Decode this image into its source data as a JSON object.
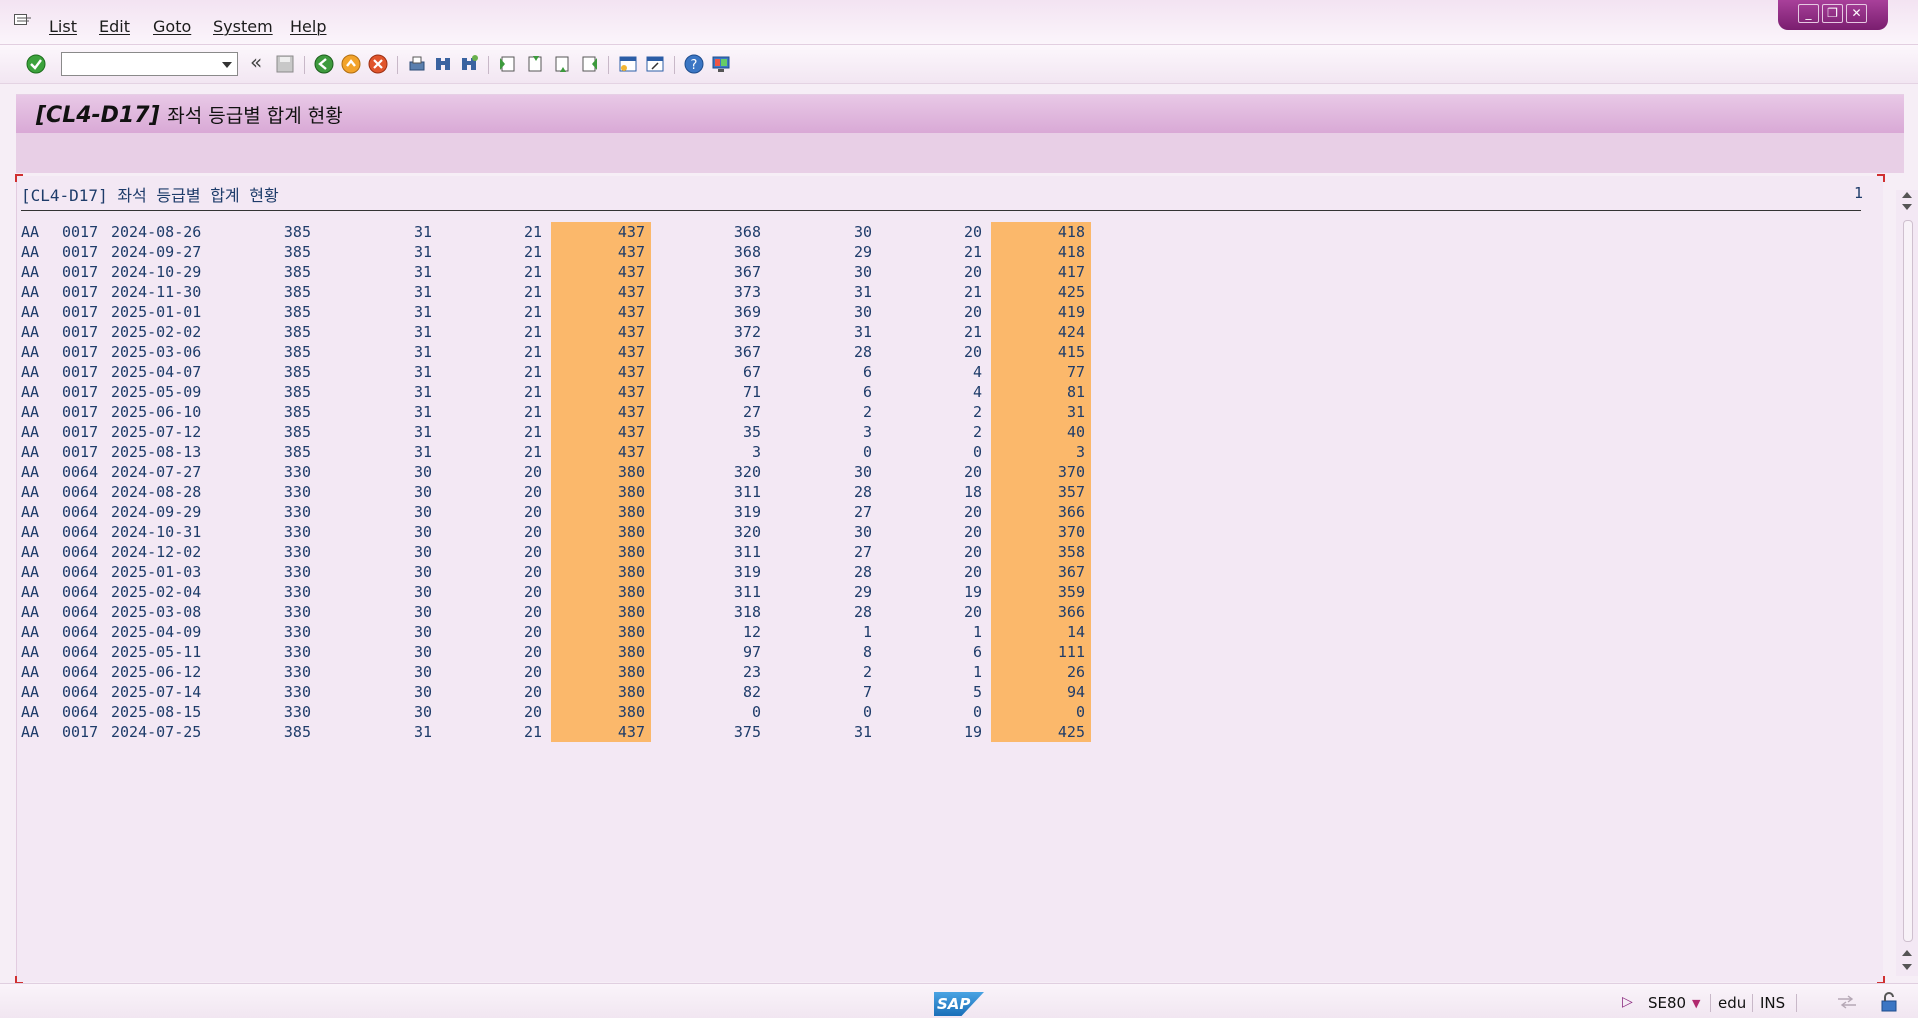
{
  "menu": {
    "items": [
      {
        "label": "List"
      },
      {
        "label": "Edit"
      },
      {
        "label": "Goto"
      },
      {
        "label": "System"
      },
      {
        "label": "Help"
      }
    ]
  },
  "toolbar": {
    "command_value": "",
    "icons": [
      "enter-check-icon",
      "save-icon",
      "back-icon",
      "exit-icon",
      "cancel-icon",
      "print-icon",
      "find-icon",
      "find-next-icon",
      "first-page-icon",
      "previous-page-icon",
      "next-page-icon",
      "last-page-icon",
      "create-session-icon",
      "shortcut-icon",
      "help-icon",
      "customize-layout-icon"
    ]
  },
  "title": {
    "code": "[CL4-D17]",
    "text": "좌석 등급별 합계 현황"
  },
  "list": {
    "header": "[CL4-D17] 좌석 등급별 합계 현황",
    "page_number": "1",
    "rows": [
      {
        "carrid": "AA",
        "connid": "0017",
        "fldate": "2024-08-26",
        "max1": "385",
        "max2": "31",
        "max3": "21",
        "tot1": "437",
        "occ1": "368",
        "occ2": "30",
        "occ3": "20",
        "tot2": "418"
      },
      {
        "carrid": "AA",
        "connid": "0017",
        "fldate": "2024-09-27",
        "max1": "385",
        "max2": "31",
        "max3": "21",
        "tot1": "437",
        "occ1": "368",
        "occ2": "29",
        "occ3": "21",
        "tot2": "418"
      },
      {
        "carrid": "AA",
        "connid": "0017",
        "fldate": "2024-10-29",
        "max1": "385",
        "max2": "31",
        "max3": "21",
        "tot1": "437",
        "occ1": "367",
        "occ2": "30",
        "occ3": "20",
        "tot2": "417"
      },
      {
        "carrid": "AA",
        "connid": "0017",
        "fldate": "2024-11-30",
        "max1": "385",
        "max2": "31",
        "max3": "21",
        "tot1": "437",
        "occ1": "373",
        "occ2": "31",
        "occ3": "21",
        "tot2": "425"
      },
      {
        "carrid": "AA",
        "connid": "0017",
        "fldate": "2025-01-01",
        "max1": "385",
        "max2": "31",
        "max3": "21",
        "tot1": "437",
        "occ1": "369",
        "occ2": "30",
        "occ3": "20",
        "tot2": "419"
      },
      {
        "carrid": "AA",
        "connid": "0017",
        "fldate": "2025-02-02",
        "max1": "385",
        "max2": "31",
        "max3": "21",
        "tot1": "437",
        "occ1": "372",
        "occ2": "31",
        "occ3": "21",
        "tot2": "424"
      },
      {
        "carrid": "AA",
        "connid": "0017",
        "fldate": "2025-03-06",
        "max1": "385",
        "max2": "31",
        "max3": "21",
        "tot1": "437",
        "occ1": "367",
        "occ2": "28",
        "occ3": "20",
        "tot2": "415"
      },
      {
        "carrid": "AA",
        "connid": "0017",
        "fldate": "2025-04-07",
        "max1": "385",
        "max2": "31",
        "max3": "21",
        "tot1": "437",
        "occ1": "67",
        "occ2": "6",
        "occ3": "4",
        "tot2": "77"
      },
      {
        "carrid": "AA",
        "connid": "0017",
        "fldate": "2025-05-09",
        "max1": "385",
        "max2": "31",
        "max3": "21",
        "tot1": "437",
        "occ1": "71",
        "occ2": "6",
        "occ3": "4",
        "tot2": "81"
      },
      {
        "carrid": "AA",
        "connid": "0017",
        "fldate": "2025-06-10",
        "max1": "385",
        "max2": "31",
        "max3": "21",
        "tot1": "437",
        "occ1": "27",
        "occ2": "2",
        "occ3": "2",
        "tot2": "31"
      },
      {
        "carrid": "AA",
        "connid": "0017",
        "fldate": "2025-07-12",
        "max1": "385",
        "max2": "31",
        "max3": "21",
        "tot1": "437",
        "occ1": "35",
        "occ2": "3",
        "occ3": "2",
        "tot2": "40"
      },
      {
        "carrid": "AA",
        "connid": "0017",
        "fldate": "2025-08-13",
        "max1": "385",
        "max2": "31",
        "max3": "21",
        "tot1": "437",
        "occ1": "3",
        "occ2": "0",
        "occ3": "0",
        "tot2": "3"
      },
      {
        "carrid": "AA",
        "connid": "0064",
        "fldate": "2024-07-27",
        "max1": "330",
        "max2": "30",
        "max3": "20",
        "tot1": "380",
        "occ1": "320",
        "occ2": "30",
        "occ3": "20",
        "tot2": "370"
      },
      {
        "carrid": "AA",
        "connid": "0064",
        "fldate": "2024-08-28",
        "max1": "330",
        "max2": "30",
        "max3": "20",
        "tot1": "380",
        "occ1": "311",
        "occ2": "28",
        "occ3": "18",
        "tot2": "357"
      },
      {
        "carrid": "AA",
        "connid": "0064",
        "fldate": "2024-09-29",
        "max1": "330",
        "max2": "30",
        "max3": "20",
        "tot1": "380",
        "occ1": "319",
        "occ2": "27",
        "occ3": "20",
        "tot2": "366"
      },
      {
        "carrid": "AA",
        "connid": "0064",
        "fldate": "2024-10-31",
        "max1": "330",
        "max2": "30",
        "max3": "20",
        "tot1": "380",
        "occ1": "320",
        "occ2": "30",
        "occ3": "20",
        "tot2": "370"
      },
      {
        "carrid": "AA",
        "connid": "0064",
        "fldate": "2024-12-02",
        "max1": "330",
        "max2": "30",
        "max3": "20",
        "tot1": "380",
        "occ1": "311",
        "occ2": "27",
        "occ3": "20",
        "tot2": "358"
      },
      {
        "carrid": "AA",
        "connid": "0064",
        "fldate": "2025-01-03",
        "max1": "330",
        "max2": "30",
        "max3": "20",
        "tot1": "380",
        "occ1": "319",
        "occ2": "28",
        "occ3": "20",
        "tot2": "367"
      },
      {
        "carrid": "AA",
        "connid": "0064",
        "fldate": "2025-02-04",
        "max1": "330",
        "max2": "30",
        "max3": "20",
        "tot1": "380",
        "occ1": "311",
        "occ2": "29",
        "occ3": "19",
        "tot2": "359"
      },
      {
        "carrid": "AA",
        "connid": "0064",
        "fldate": "2025-03-08",
        "max1": "330",
        "max2": "30",
        "max3": "20",
        "tot1": "380",
        "occ1": "318",
        "occ2": "28",
        "occ3": "20",
        "tot2": "366"
      },
      {
        "carrid": "AA",
        "connid": "0064",
        "fldate": "2025-04-09",
        "max1": "330",
        "max2": "30",
        "max3": "20",
        "tot1": "380",
        "occ1": "12",
        "occ2": "1",
        "occ3": "1",
        "tot2": "14"
      },
      {
        "carrid": "AA",
        "connid": "0064",
        "fldate": "2025-05-11",
        "max1": "330",
        "max2": "30",
        "max3": "20",
        "tot1": "380",
        "occ1": "97",
        "occ2": "8",
        "occ3": "6",
        "tot2": "111"
      },
      {
        "carrid": "AA",
        "connid": "0064",
        "fldate": "2025-06-12",
        "max1": "330",
        "max2": "30",
        "max3": "20",
        "tot1": "380",
        "occ1": "23",
        "occ2": "2",
        "occ3": "1",
        "tot2": "26"
      },
      {
        "carrid": "AA",
        "connid": "0064",
        "fldate": "2025-07-14",
        "max1": "330",
        "max2": "30",
        "max3": "20",
        "tot1": "380",
        "occ1": "82",
        "occ2": "7",
        "occ3": "5",
        "tot2": "94"
      },
      {
        "carrid": "AA",
        "connid": "0064",
        "fldate": "2025-08-15",
        "max1": "330",
        "max2": "30",
        "max3": "20",
        "tot1": "380",
        "occ1": "0",
        "occ2": "0",
        "occ3": "0",
        "tot2": "0"
      },
      {
        "carrid": "AA",
        "connid": "0017",
        "fldate": "2024-07-25",
        "max1": "385",
        "max2": "31",
        "max3": "21",
        "tot1": "437",
        "occ1": "375",
        "occ2": "31",
        "occ3": "19",
        "tot2": "425"
      }
    ]
  },
  "status": {
    "logo": "SAP",
    "transaction": "SE80",
    "client": "edu",
    "mode": "INS"
  },
  "colors": {
    "highlight": "#fbb86b",
    "list_text": "#1e3c6a",
    "title_bar": "#d9a9d6",
    "window_controls": "#8a2a7e"
  }
}
